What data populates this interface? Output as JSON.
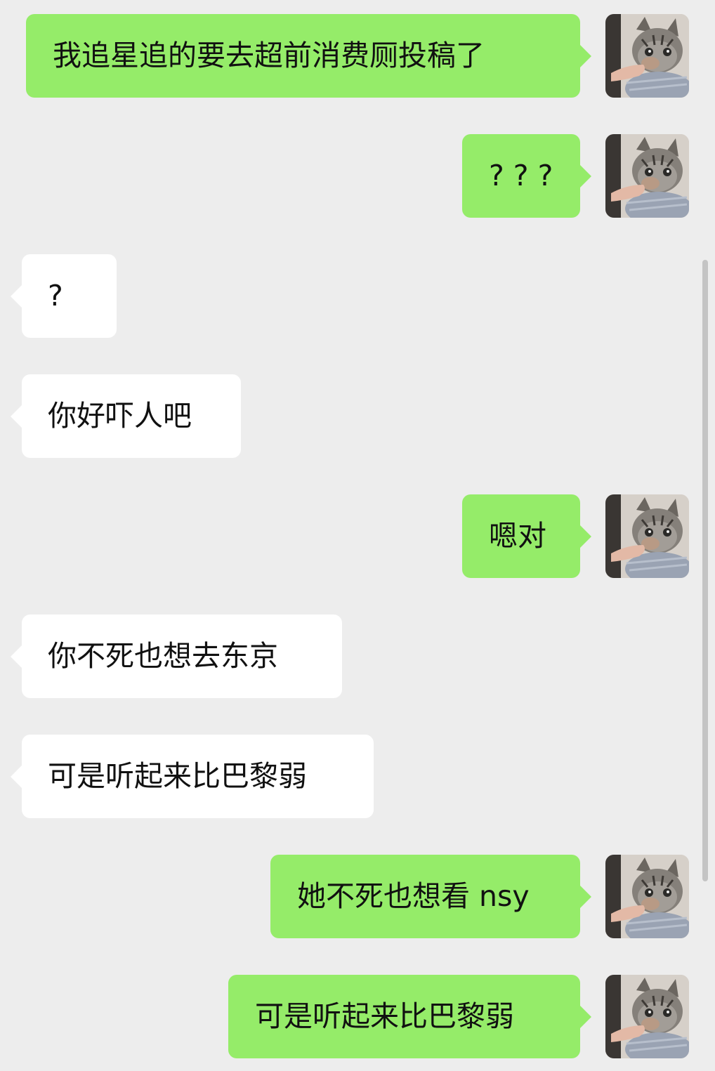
{
  "colors": {
    "background": "#ededed",
    "outgoing_bubble": "#95ec69",
    "incoming_bubble": "#ffffff",
    "text": "#111111"
  },
  "avatar": {
    "icon": "cat-avatar-icon"
  },
  "messages": [
    {
      "side": "me",
      "text": "我追星追的要去超前消费厕投稿了"
    },
    {
      "side": "me",
      "text": "? ? ?"
    },
    {
      "side": "them",
      "text": "?"
    },
    {
      "side": "them",
      "text": "你好吓人吧"
    },
    {
      "side": "me",
      "text": "嗯对"
    },
    {
      "side": "them",
      "text": "你不死也想去东京"
    },
    {
      "side": "them",
      "text": "可是听起来比巴黎弱"
    },
    {
      "side": "me",
      "text": "她不死也想看 nsy"
    },
    {
      "side": "me",
      "text": "可是听起来比巴黎弱"
    }
  ]
}
